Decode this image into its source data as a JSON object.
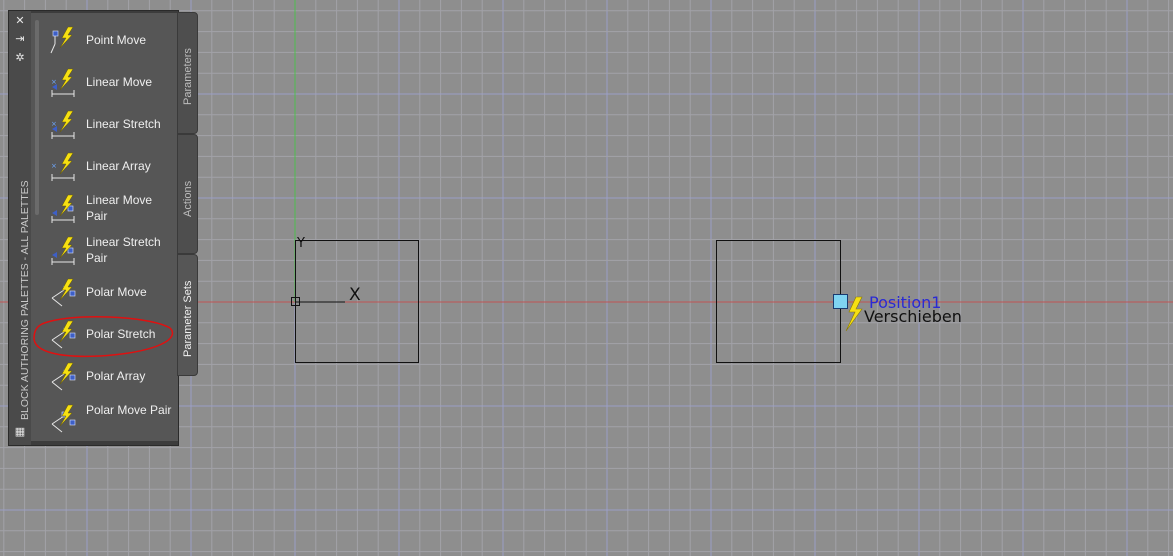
{
  "palette": {
    "title": "BLOCK AUTHORING PALETTES - ALL PALETTES",
    "tabs": [
      "Parameters",
      "Actions",
      "Parameter Sets"
    ],
    "active_tab": "Parameter Sets",
    "items": [
      {
        "label": "Point Move",
        "icon": "point-move-icon"
      },
      {
        "label": "Linear Move",
        "icon": "linear-move-icon"
      },
      {
        "label": "Linear Stretch",
        "icon": "linear-stretch-icon"
      },
      {
        "label": "Linear Array",
        "icon": "linear-array-icon"
      },
      {
        "label": "Linear Move Pair",
        "icon": "linear-move-pair-icon"
      },
      {
        "label": "Linear Stretch Pair",
        "icon": "linear-stretch-pair-icon"
      },
      {
        "label": "Polar Move",
        "icon": "polar-move-icon"
      },
      {
        "label": "Polar Stretch",
        "icon": "polar-stretch-icon"
      },
      {
        "label": "Polar Array",
        "icon": "polar-array-icon"
      },
      {
        "label": "Polar Move Pair",
        "icon": "polar-move-pair-icon"
      }
    ],
    "highlighted_item": "Polar Stretch"
  },
  "drawing": {
    "ucs_x_label": "X",
    "ucs_y_label": "Y",
    "parameter_label": "Position1",
    "action_label": "Verschieben"
  },
  "colors": {
    "canvas_bg": "#8e8e8e",
    "grid_minor": "#a2a2a8",
    "grid_major": "#9b9fc6",
    "x_axis": "#c05454",
    "y_axis": "#4fbf4f",
    "parameter_text": "#2a2ad4",
    "action_text": "#111111",
    "highlight_ring": "#e01010",
    "lightning": "#f6e012"
  }
}
